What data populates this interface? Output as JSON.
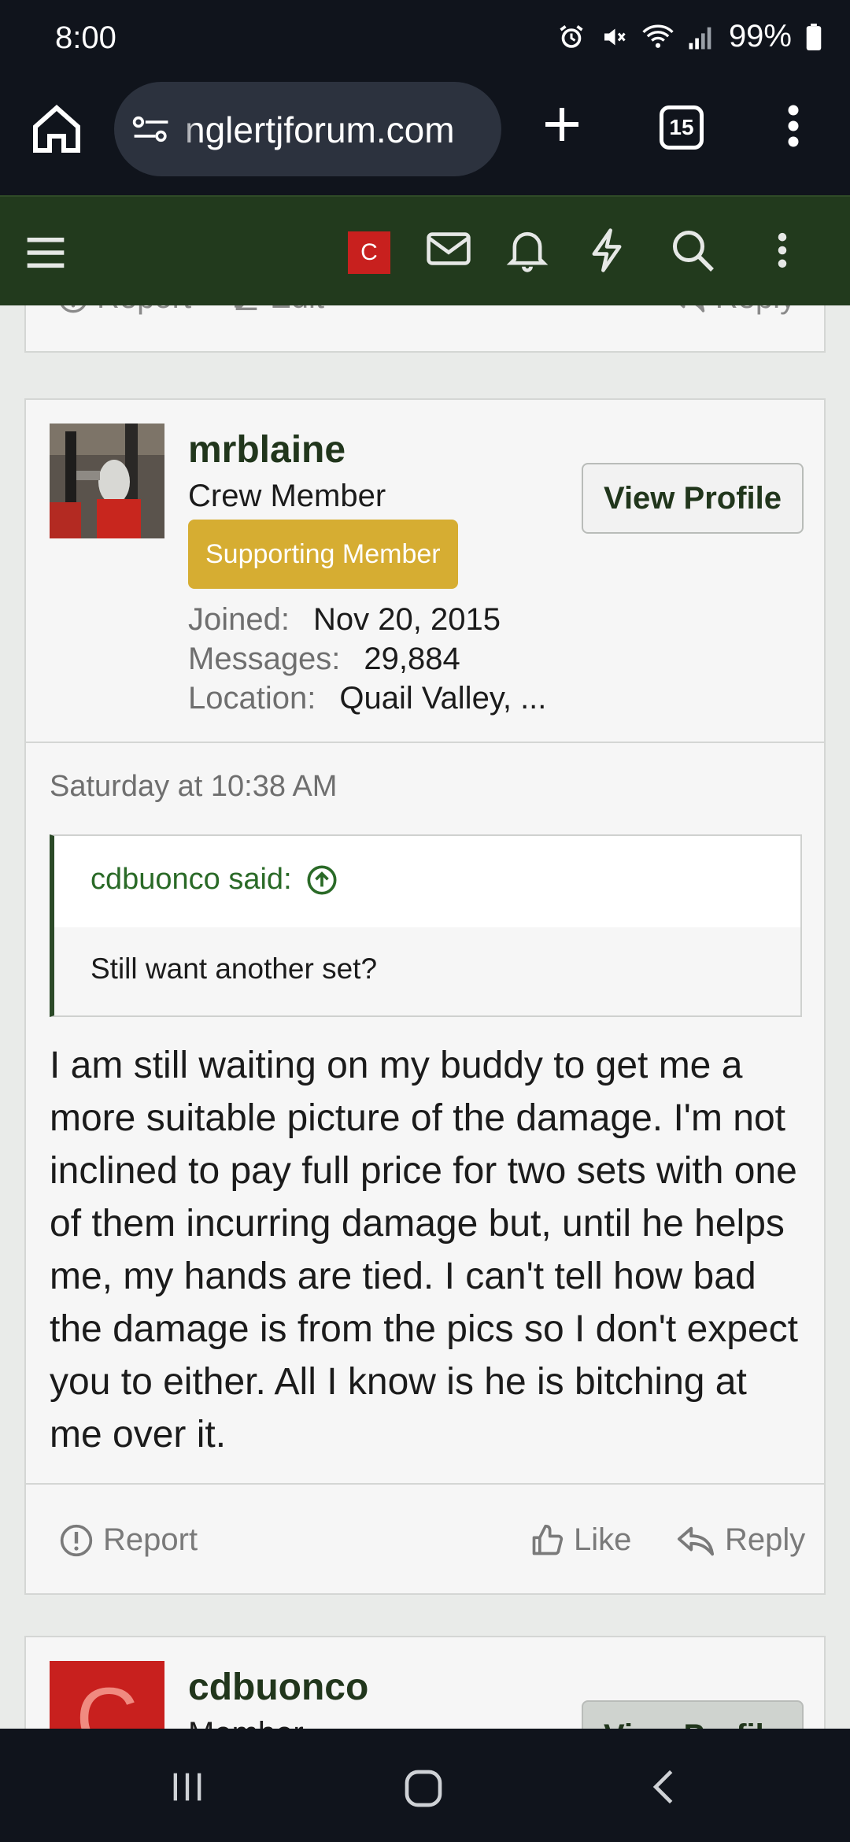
{
  "status_bar": {
    "time": "8:00",
    "battery": "99%"
  },
  "browser": {
    "url": "nglertjforum.com",
    "tab_count": "15"
  },
  "forum_nav": {
    "avatar_letter": "C"
  },
  "previous_post": {
    "report_label": "Report",
    "edit_label": "Edit",
    "reply_label": "Reply"
  },
  "post": {
    "username": "mrblaine",
    "user_title": "Crew Member",
    "badge": "Supporting Member",
    "view_profile_label": "View Profile",
    "stats": [
      {
        "label": "Joined:",
        "value": "Nov 20, 2015"
      },
      {
        "label": "Messages:",
        "value": "29,884"
      },
      {
        "label": "Location:",
        "value": "Quail Valley, ..."
      }
    ],
    "date": "Saturday at 10:38 AM",
    "quote": {
      "author": "cdbuonco said:",
      "text": "Still want another set?"
    },
    "body": "I am still waiting on my buddy to get me a more suitable picture of the damage. I'm not inclined to pay full price for two sets with one of them incurring damage but, until he helps me, my hands are tied. I can't tell how bad the damage is from the pics so I don't expect you to either. All I know is he is bitching at me over it.",
    "actions": {
      "report_label": "Report",
      "like_label": "Like",
      "reply_label": "Reply"
    }
  },
  "next_post": {
    "avatar_letter": "C",
    "username": "cdbuonco",
    "user_title": "Member",
    "view_profile_label": "View Profile"
  },
  "colors": {
    "forum_nav": "#223a1d",
    "badge": "#d6ad32",
    "link_green": "#2a6a27",
    "avatar_red": "#c8201e"
  }
}
